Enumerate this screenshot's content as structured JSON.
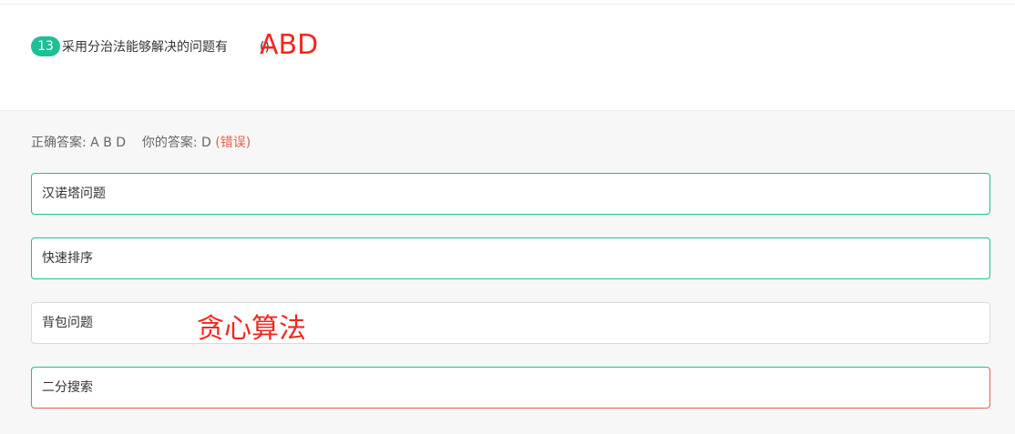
{
  "question": {
    "number": "13",
    "text": "采用分治法能够解决的问题有",
    "paren": "()"
  },
  "handwriting": {
    "answer_mark": "ABD",
    "option3_note": "贪心算法"
  },
  "result": {
    "correct_label": "正确答案:",
    "correct_value": "A B D",
    "your_label": "你的答案:",
    "your_value": "D",
    "status": "(错误)"
  },
  "options": [
    {
      "label": "汉诺塔问题"
    },
    {
      "label": "快速排序"
    },
    {
      "label": "背包问题"
    },
    {
      "label": "二分搜索"
    }
  ],
  "colors": {
    "accent_green": "#1dbf97",
    "error_red": "#e8604c",
    "handwriting_red": "#f0281f"
  }
}
